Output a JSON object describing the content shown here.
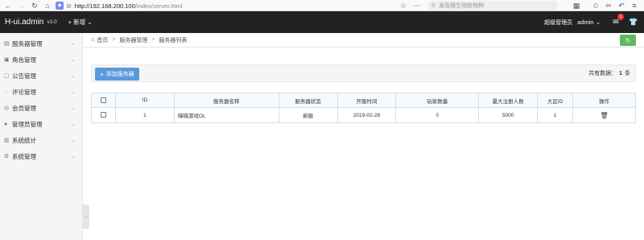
{
  "browser": {
    "url_host": "http://192.168.200.100",
    "url_path": "/index/server.html",
    "search_placeholder": "发现微生物新物种"
  },
  "header": {
    "logo": "H-ui.admin",
    "version": "v3.0",
    "add_menu": "+ 新增",
    "role": "超级管理员",
    "user": "admin",
    "msg_count": "1"
  },
  "sidebar": {
    "items": [
      {
        "label": "服务器管理"
      },
      {
        "label": "角色管理"
      },
      {
        "label": "公告管理"
      },
      {
        "label": "评论管理"
      },
      {
        "label": "会员管理"
      },
      {
        "label": "管理员管理"
      },
      {
        "label": "系统统计"
      },
      {
        "label": "系统管理"
      }
    ]
  },
  "breadcrumb": {
    "home": "首页",
    "level1": "服务器管理",
    "level2": "服务器列表"
  },
  "toolbar": {
    "add_label": "添加服务器",
    "total_prefix": "共有数据：",
    "total_count": "1",
    "total_suffix": "条"
  },
  "table": {
    "headers": [
      "ID",
      "服务器名称",
      "服务器状态",
      "开服时间",
      "玩家数量",
      "最大注册人数",
      "大区ID",
      "操作"
    ],
    "rows": [
      {
        "id": "1",
        "name": "嗨嗨游戏OL",
        "status": "新服",
        "open_date": "2019-02-28",
        "players": "0",
        "max_reg": "5000",
        "region_id": "1"
      }
    ]
  },
  "colors": {
    "header_bg": "#222222",
    "accent_blue": "#5a98de",
    "refresh_green": "#5eb95e",
    "badge_red": "#ee3333"
  }
}
